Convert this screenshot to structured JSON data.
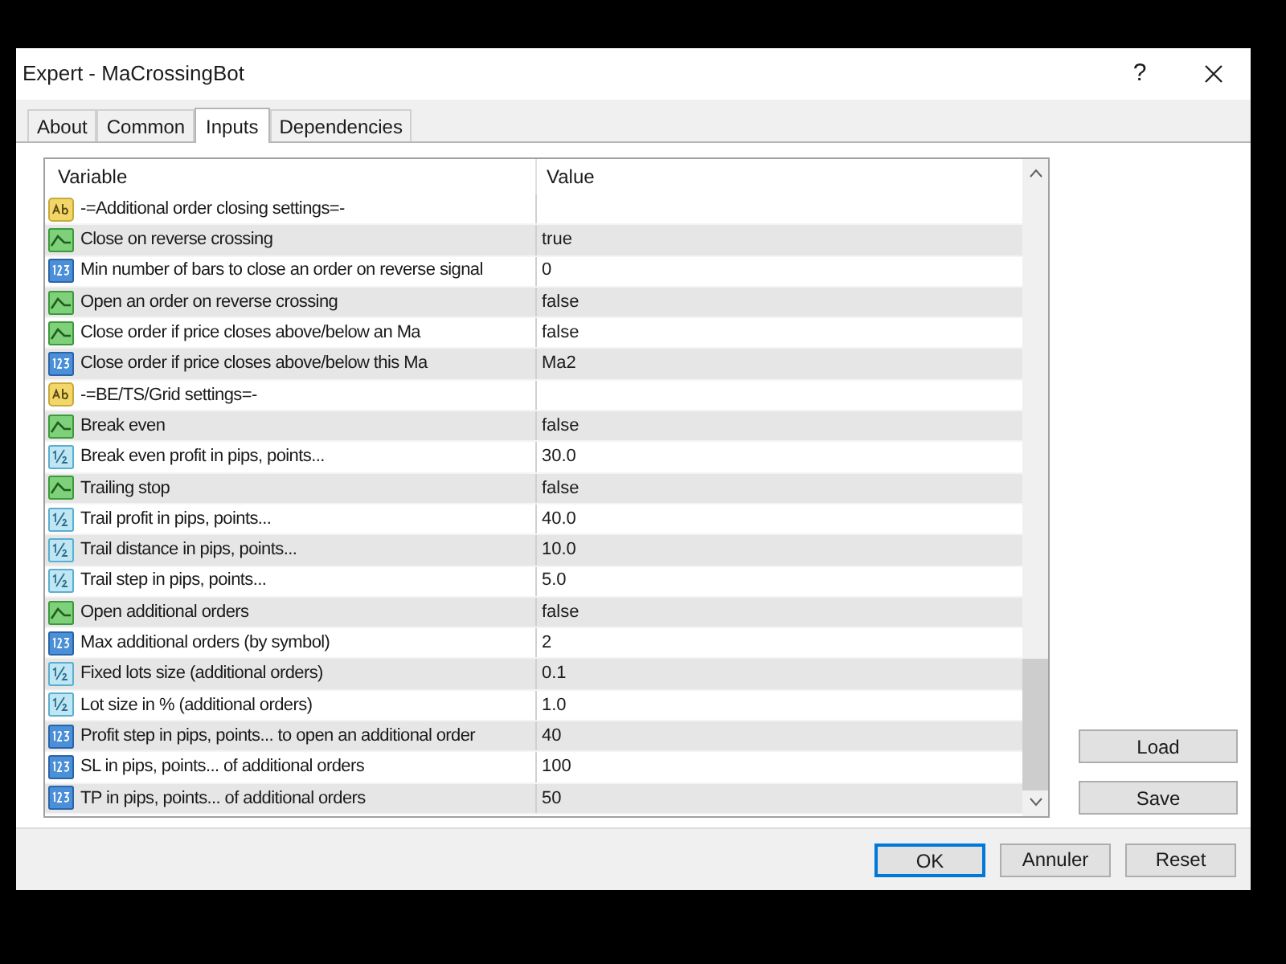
{
  "window": {
    "title": "Expert - MaCrossingBot",
    "help": "?"
  },
  "tabs": [
    {
      "label": "About",
      "selected": false
    },
    {
      "label": "Common",
      "selected": false
    },
    {
      "label": "Inputs",
      "selected": true
    },
    {
      "label": "Dependencies",
      "selected": false
    }
  ],
  "table": {
    "columns": [
      "Variable",
      "Value"
    ],
    "rows": [
      {
        "kind": "string",
        "variable": "-=Additional order closing settings=-",
        "value": ""
      },
      {
        "kind": "bool",
        "variable": "Close on reverse crossing",
        "value": "true"
      },
      {
        "kind": "int",
        "variable": "Min number of bars to close an order on reverse signal",
        "value": "0"
      },
      {
        "kind": "bool",
        "variable": "Open an order on reverse crossing",
        "value": "false"
      },
      {
        "kind": "bool",
        "variable": "Close order if price closes above/below an Ma",
        "value": "false"
      },
      {
        "kind": "int",
        "variable": "Close order if price closes above/below this Ma",
        "value": "Ma2"
      },
      {
        "kind": "string",
        "variable": "-=BE/TS/Grid settings=-",
        "value": ""
      },
      {
        "kind": "bool",
        "variable": "Break even",
        "value": "false"
      },
      {
        "kind": "double",
        "variable": "Break even profit in pips, points...",
        "value": "30.0"
      },
      {
        "kind": "bool",
        "variable": "Trailing stop",
        "value": "false"
      },
      {
        "kind": "double",
        "variable": "Trail profit in pips, points...",
        "value": "40.0"
      },
      {
        "kind": "double",
        "variable": "Trail distance in pips, points...",
        "value": "10.0"
      },
      {
        "kind": "double",
        "variable": "Trail step in pips, points...",
        "value": "5.0"
      },
      {
        "kind": "bool",
        "variable": "Open additional orders",
        "value": "false"
      },
      {
        "kind": "int",
        "variable": "Max additional orders (by symbol)",
        "value": "2"
      },
      {
        "kind": "double",
        "variable": "Fixed lots size (additional orders)",
        "value": "0.1"
      },
      {
        "kind": "double",
        "variable": "Lot size in % (additional orders)",
        "value": "1.0"
      },
      {
        "kind": "int",
        "variable": "Profit step in pips, points... to open an additional order",
        "value": "40"
      },
      {
        "kind": "int",
        "variable": "SL in pips, points... of additional orders",
        "value": "100"
      },
      {
        "kind": "int",
        "variable": "TP in pips, points... of additional orders",
        "value": "50"
      }
    ]
  },
  "side_buttons": [
    "Load",
    "Save"
  ],
  "buttons": [
    {
      "label": "OK",
      "default": true
    },
    {
      "label": "Annuler",
      "default": false
    },
    {
      "label": "Reset",
      "default": false
    }
  ]
}
